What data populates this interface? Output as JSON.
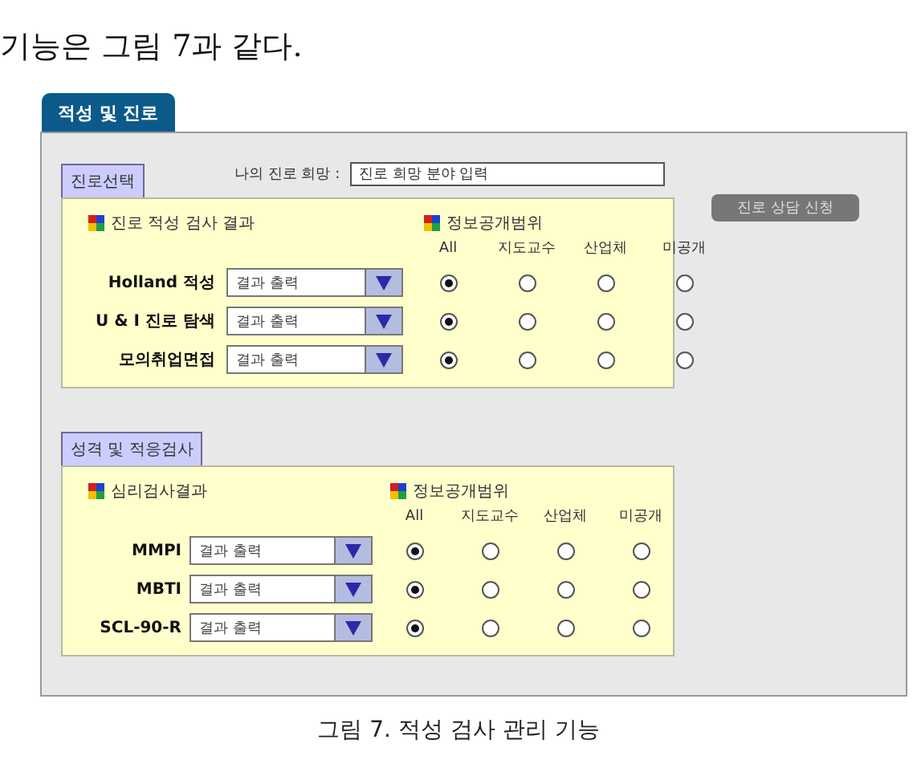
{
  "intro_text": "기능은 그림 7과 같다.",
  "tab": {
    "label": "적성 및 진로",
    "selected": true
  },
  "career_wish": {
    "label": "나의 진로 희망 :",
    "value": "진로 희망 분야 입력"
  },
  "consult_button": "진로 상담 신청",
  "sections": [
    {
      "label": "진로선택",
      "results_title": "진로 적성 검사 결과",
      "scope_title": "정보공개범위",
      "scope_options": [
        "All",
        "지도교수",
        "산업체",
        "미공개"
      ],
      "rows": [
        {
          "name": "Holland 적성",
          "dropdown": "결과 출력",
          "options": [
            {
              "selected": true
            },
            {
              "selected": false
            },
            {
              "selected": false
            },
            {
              "selected": false
            }
          ]
        },
        {
          "name": "U & I 진로 탐색",
          "dropdown": "결과 출력",
          "options": [
            {
              "selected": true
            },
            {
              "selected": false
            },
            {
              "selected": false
            },
            {
              "selected": false
            }
          ]
        },
        {
          "name": "모의취업면접",
          "dropdown": "결과 출력",
          "options": [
            {
              "selected": true
            },
            {
              "selected": false
            },
            {
              "selected": false
            },
            {
              "selected": false
            }
          ]
        }
      ]
    },
    {
      "label": "성격 및 적응검사",
      "results_title": "심리검사결과",
      "scope_title": "정보공개범위",
      "scope_options": [
        "All",
        "지도교수",
        "산업체",
        "미공개"
      ],
      "rows": [
        {
          "name": "MMPI",
          "dropdown": "결과 출력",
          "options": [
            {
              "selected": true
            },
            {
              "selected": false
            },
            {
              "selected": false
            },
            {
              "selected": false
            }
          ]
        },
        {
          "name": "MBTI",
          "dropdown": "결과 출력",
          "options": [
            {
              "selected": true
            },
            {
              "selected": false
            },
            {
              "selected": false
            },
            {
              "selected": false
            }
          ]
        },
        {
          "name": "SCL-90-R",
          "dropdown": "결과 출력",
          "options": [
            {
              "selected": true
            },
            {
              "selected": false
            },
            {
              "selected": false
            },
            {
              "selected": false
            }
          ]
        }
      ]
    }
  ],
  "caption": "그림 7. 적성 검사 관리 기능"
}
